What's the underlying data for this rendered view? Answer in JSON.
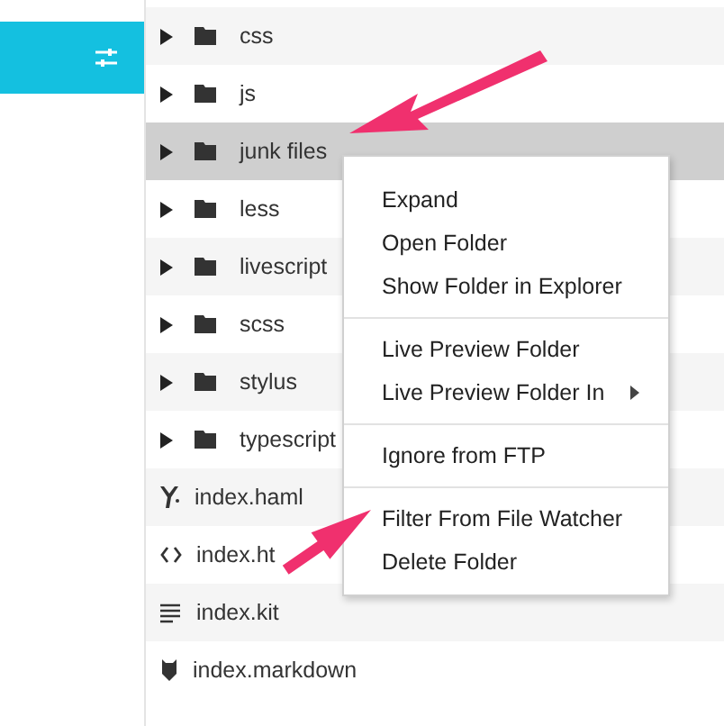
{
  "sidebar": {
    "header": {
      "kind": "filter"
    }
  },
  "tree": [
    {
      "kind": "folder",
      "label": "css",
      "selected": false
    },
    {
      "kind": "folder",
      "label": "js",
      "selected": false
    },
    {
      "kind": "folder",
      "label": "junk files",
      "selected": true
    },
    {
      "kind": "folder",
      "label": "less",
      "selected": false
    },
    {
      "kind": "folder",
      "label": "livescript",
      "selected": false
    },
    {
      "kind": "folder",
      "label": "scss",
      "selected": false
    },
    {
      "kind": "folder",
      "label": "stylus",
      "selected": false
    },
    {
      "kind": "folder",
      "label": "typescript",
      "selected": false
    },
    {
      "kind": "haml",
      "label": "index.haml",
      "selected": false
    },
    {
      "kind": "html",
      "label": "index.ht",
      "selected": false
    },
    {
      "kind": "kit",
      "label": "index.kit",
      "selected": false
    },
    {
      "kind": "markdown",
      "label": "index.markdown",
      "selected": false
    }
  ],
  "context_menu": {
    "groups": [
      [
        {
          "label": "Expand",
          "submenu": false
        },
        {
          "label": "Open Folder",
          "submenu": false
        },
        {
          "label": "Show Folder in Explorer",
          "submenu": false
        }
      ],
      [
        {
          "label": "Live Preview Folder",
          "submenu": false
        },
        {
          "label": "Live Preview Folder In",
          "submenu": true
        }
      ],
      [
        {
          "label": "Ignore from FTP",
          "submenu": false
        }
      ],
      [
        {
          "label": "Filter From File Watcher",
          "submenu": false
        },
        {
          "label": "Delete Folder",
          "submenu": false
        }
      ]
    ]
  }
}
